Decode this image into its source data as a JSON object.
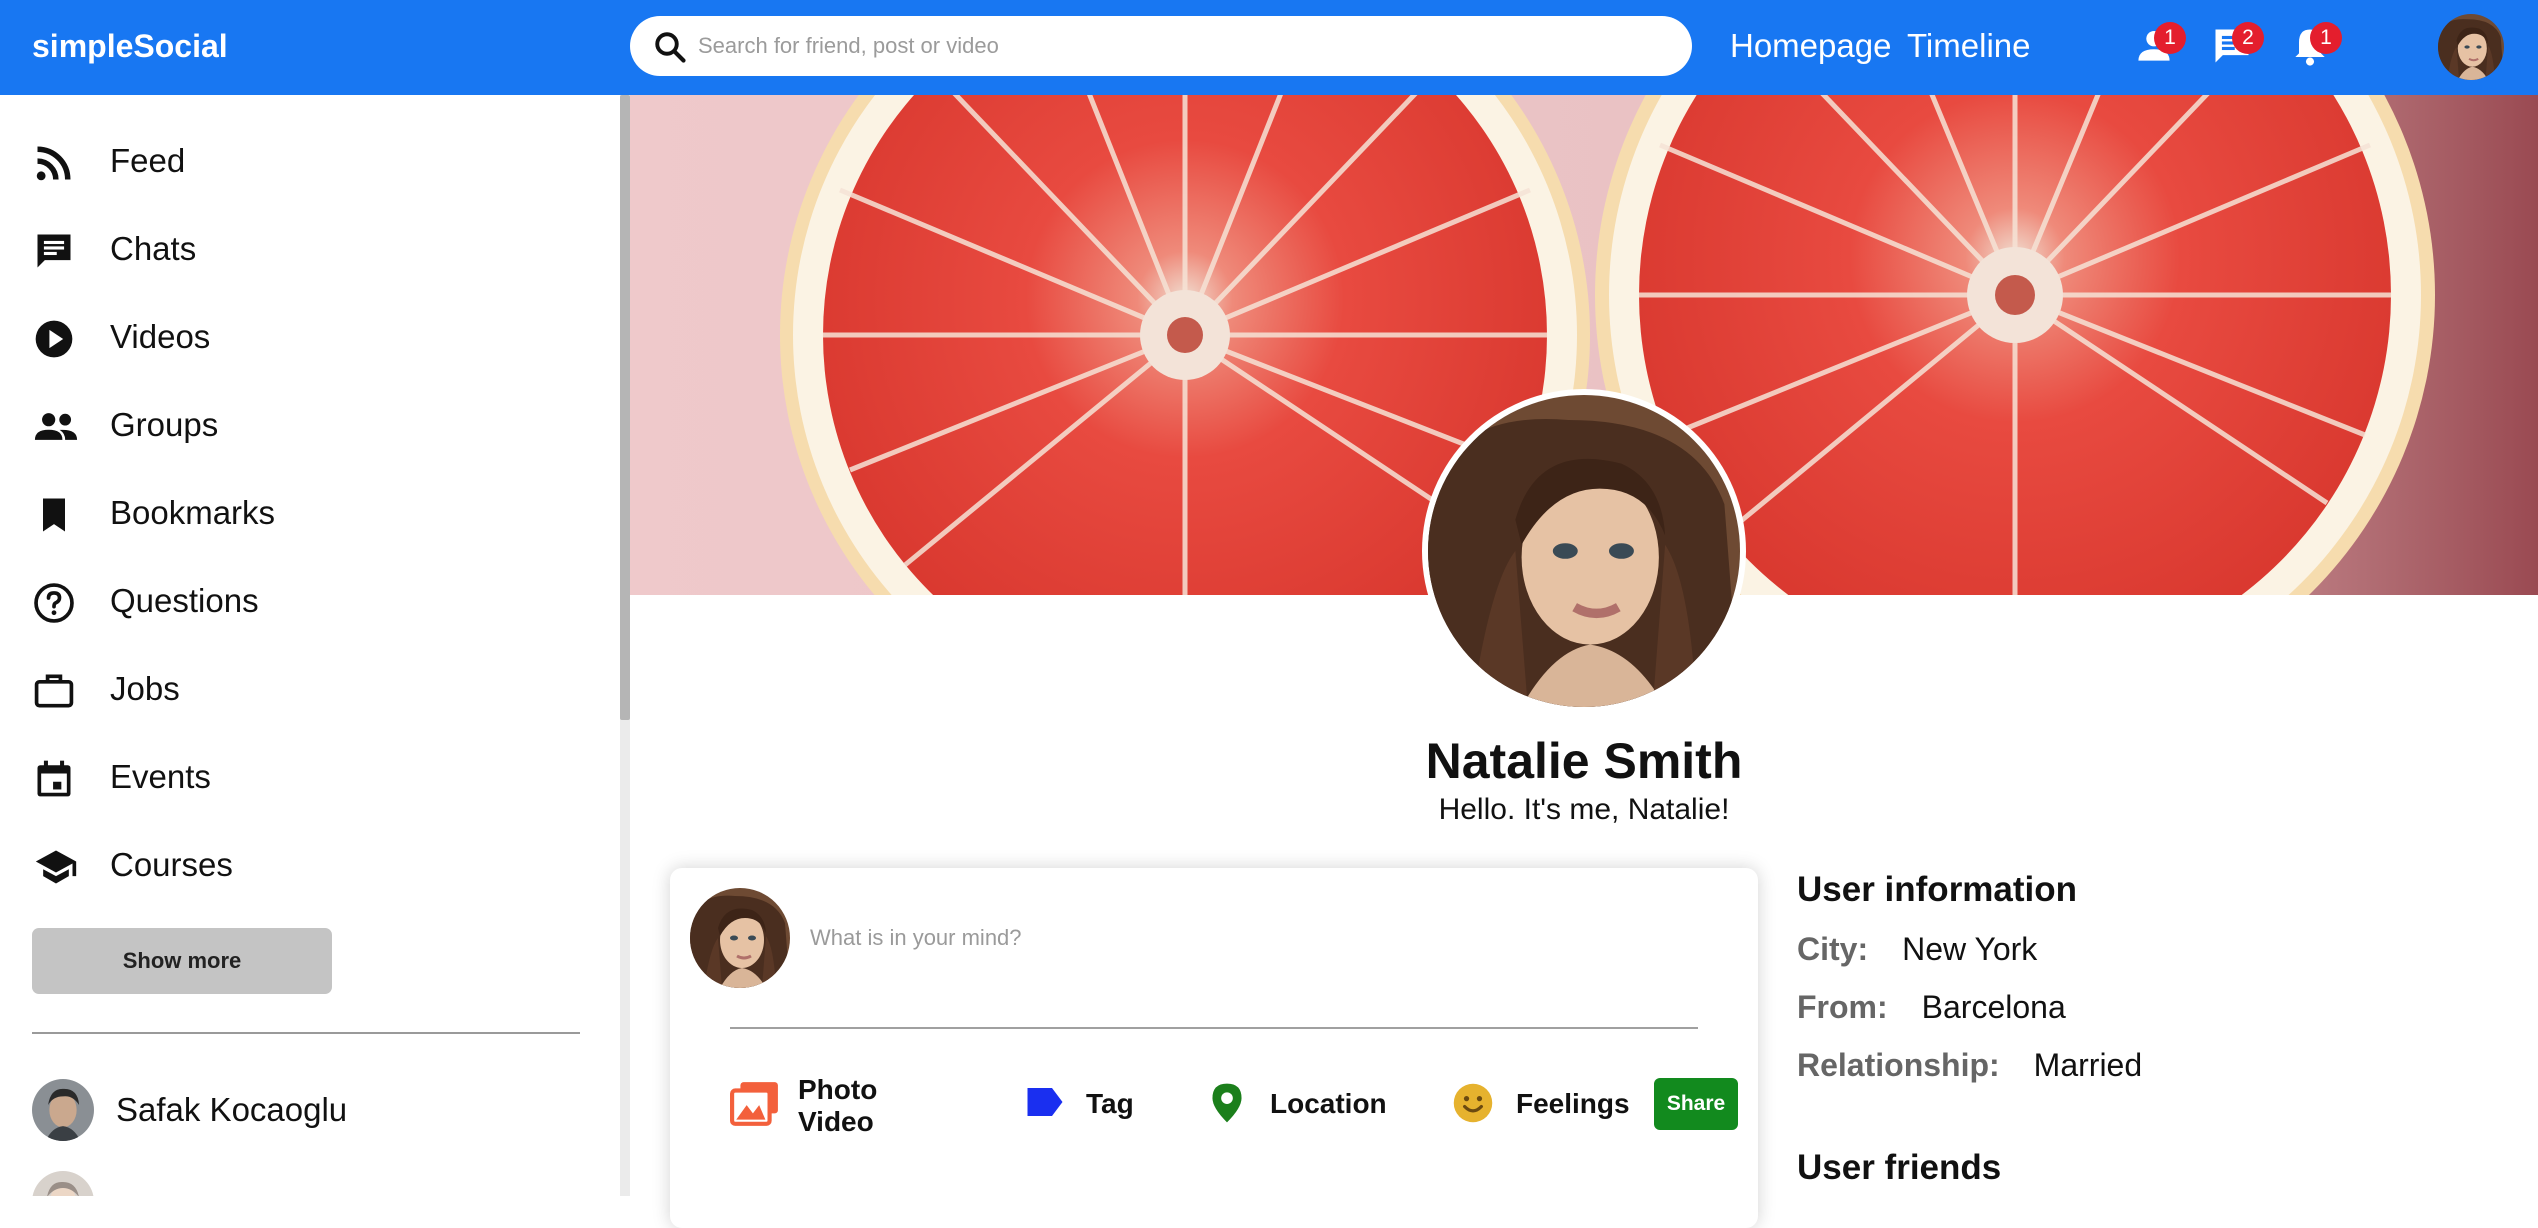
{
  "topbar": {
    "logo": "simpleSocial",
    "search_placeholder": "Search for friend, post or video",
    "links": [
      "Homepage",
      "Timeline"
    ],
    "icons": [
      {
        "name": "person-icon",
        "badge": "1"
      },
      {
        "name": "chat-icon",
        "badge": "2"
      },
      {
        "name": "bell-icon",
        "badge": "1"
      }
    ],
    "accent_color": "#1877f2",
    "badge_color": "#e41e2d"
  },
  "sidebar": {
    "items": [
      {
        "label": "Feed",
        "icon": "rss-feed-icon"
      },
      {
        "label": "Chats",
        "icon": "chat-icon"
      },
      {
        "label": "Videos",
        "icon": "play-circle-icon"
      },
      {
        "label": "Groups",
        "icon": "group-icon"
      },
      {
        "label": "Bookmarks",
        "icon": "bookmark-icon"
      },
      {
        "label": "Questions",
        "icon": "help-circle-icon"
      },
      {
        "label": "Jobs",
        "icon": "briefcase-icon"
      },
      {
        "label": "Events",
        "icon": "calendar-icon"
      },
      {
        "label": "Courses",
        "icon": "school-icon"
      }
    ],
    "show_more": "Show more",
    "friends": [
      "Safak Kocaoglu"
    ]
  },
  "profile": {
    "name": "Natalie Smith",
    "description": "Hello. It's me, Natalie!",
    "cover_image": "grapefruit halves on pink background"
  },
  "share": {
    "placeholder": "What is in your mind?",
    "options": [
      {
        "label": "Photo Video",
        "label_line1": "Photo",
        "label_line2": "Video",
        "icon": "photo-library-icon",
        "color": "#f3603c"
      },
      {
        "label": "Tag",
        "icon": "label-icon",
        "color": "#1a2ff0"
      },
      {
        "label": "Location",
        "icon": "location-pin-icon",
        "color": "#1b7f1b"
      },
      {
        "label": "Feelings",
        "icon": "emoji-icon",
        "color": "#e6b22e"
      }
    ],
    "button": "Share",
    "button_color": "#128a1e"
  },
  "user_info": {
    "title": "User information",
    "rows": [
      {
        "key": "City:",
        "value": "New York"
      },
      {
        "key": "From:",
        "value": "Barcelona"
      },
      {
        "key": "Relationship:",
        "value": "Married"
      }
    ],
    "friends_title": "User friends"
  }
}
